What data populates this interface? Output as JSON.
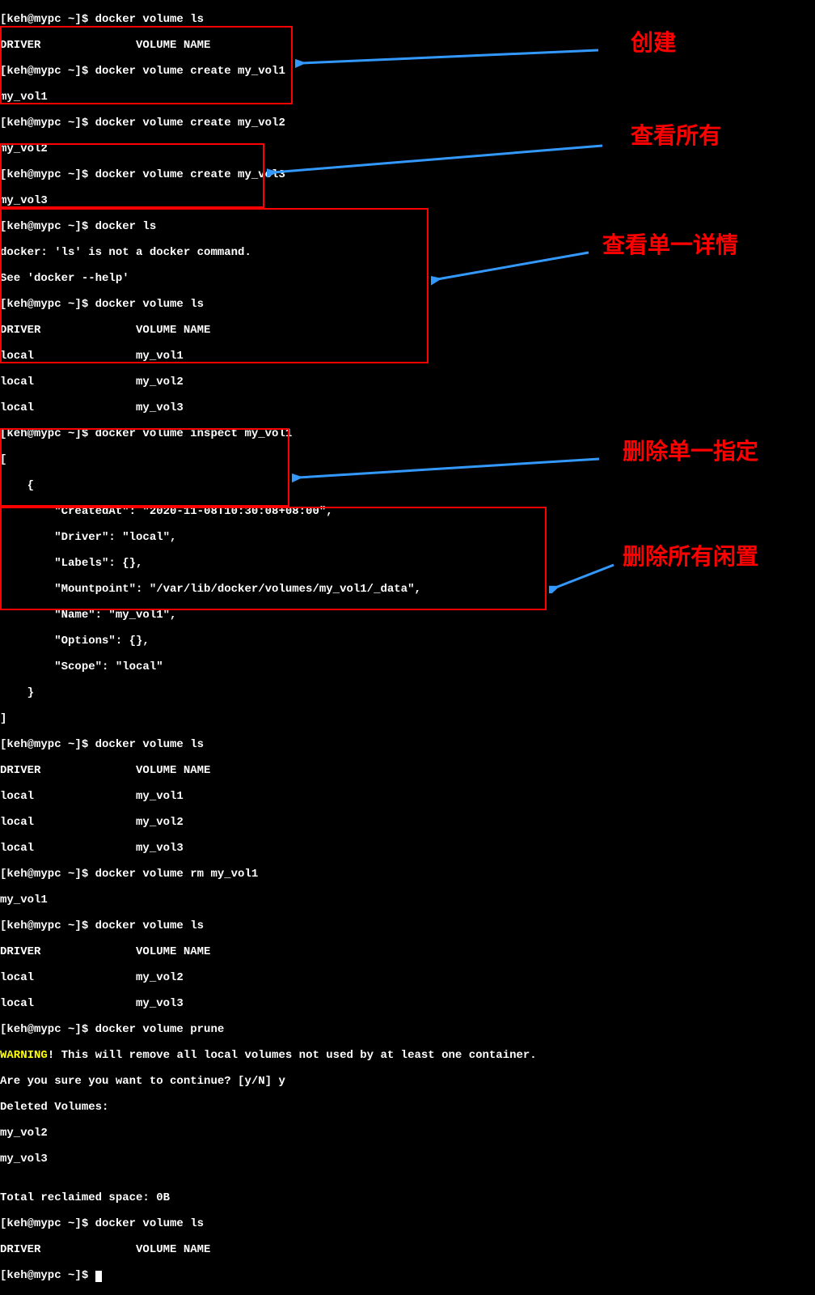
{
  "prompt": "[keh@mypc ~]$ ",
  "header_driver": "DRIVER              VOLUME NAME",
  "sections": {
    "top_lines": [
      "[keh@mypc ~]$ docker volume ls",
      "DRIVER              VOLUME NAME"
    ],
    "create": {
      "lines": [
        "[keh@mypc ~]$ docker volume create my_vol1",
        "my_vol1",
        "[keh@mypc ~]$ docker volume create my_vol2",
        "my_vol2",
        "[keh@mypc ~]$ docker volume create my_vol3",
        "my_vol3"
      ],
      "label": "创建"
    },
    "ls_error": [
      "[keh@mypc ~]$ docker ls",
      "docker: 'ls' is not a docker command.",
      "See 'docker --help'"
    ],
    "list_all": {
      "lines": [
        "[keh@mypc ~]$ docker volume ls",
        "DRIVER              VOLUME NAME",
        "local               my_vol1",
        "local               my_vol2",
        "local               my_vol3"
      ],
      "label": "查看所有"
    },
    "inspect": {
      "lines": [
        "[keh@mypc ~]$ docker volume inspect my_vol1",
        "[",
        "    {",
        "        \"CreatedAt\": \"2020-11-08T10:30:08+08:00\",",
        "        \"Driver\": \"local\",",
        "        \"Labels\": {},",
        "        \"Mountpoint\": \"/var/lib/docker/volumes/my_vol1/_data\",",
        "        \"Name\": \"my_vol1\",",
        "        \"Options\": {},",
        "        \"Scope\": \"local\"",
        "    }",
        "]"
      ],
      "label": "查看单一详情"
    },
    "list_after_inspect": [
      "[keh@mypc ~]$ docker volume ls",
      "DRIVER              VOLUME NAME",
      "local               my_vol1",
      "local               my_vol2",
      "local               my_vol3"
    ],
    "remove_one": {
      "lines": [
        "[keh@mypc ~]$ docker volume rm my_vol1",
        "my_vol1",
        "[keh@mypc ~]$ docker volume ls",
        "DRIVER              VOLUME NAME",
        "local               my_vol2",
        "local               my_vol3"
      ],
      "label": "删除单一指定"
    },
    "prune": {
      "cmd": "[keh@mypc ~]$ docker volume prune",
      "warning_word": "WARNING",
      "warning_rest": "! This will remove all local volumes not used by at least one container.",
      "confirm": "Are you sure you want to continue? [y/N] y",
      "deleted_header": "Deleted Volumes:",
      "deleted": [
        "my_vol2",
        "my_vol3"
      ],
      "blank": "",
      "reclaimed": "Total reclaimed space: 0B",
      "final_ls": [
        "[keh@mypc ~]$ docker volume ls",
        "DRIVER              VOLUME NAME"
      ],
      "final_prompt": "[keh@mypc ~]$ ",
      "label": "删除所有闲置"
    }
  }
}
